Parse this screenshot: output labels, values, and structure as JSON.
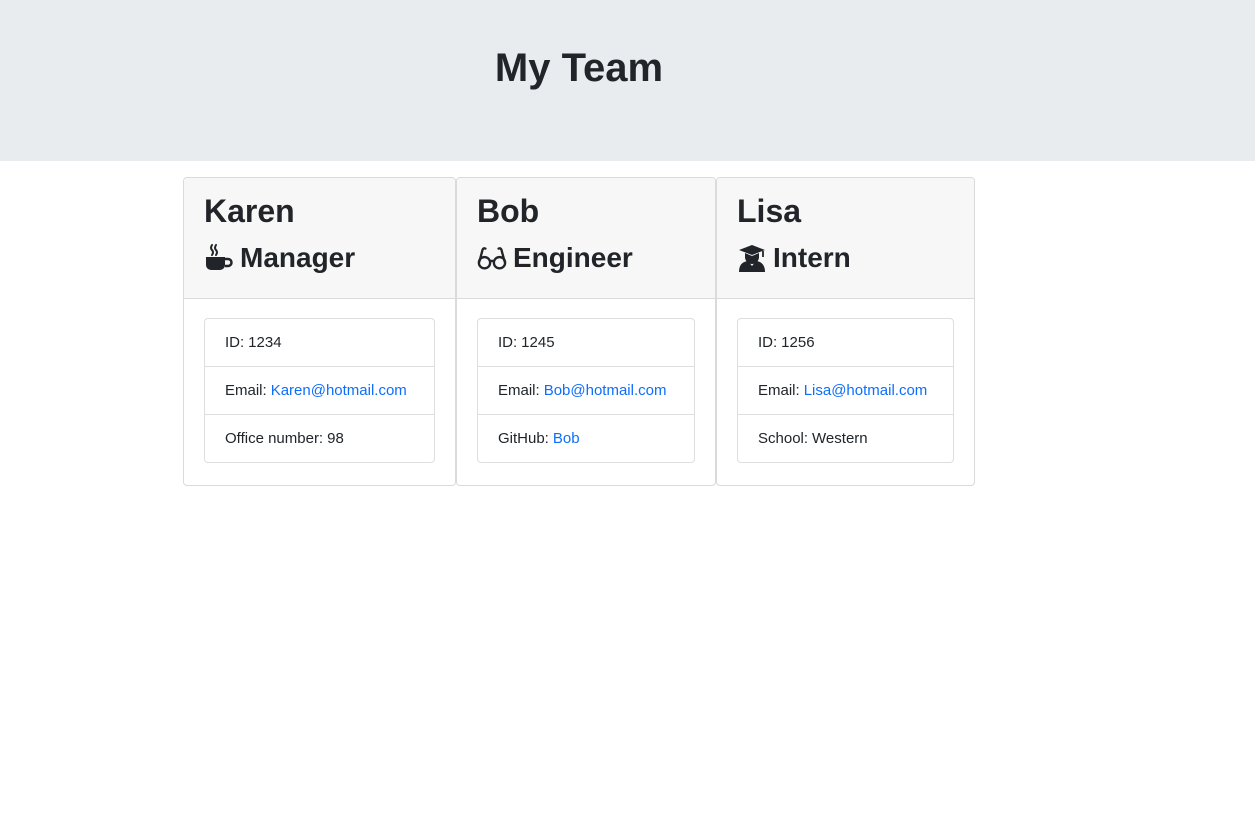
{
  "header": {
    "title": "My Team"
  },
  "colors": {
    "jumbotron_bg": "#e9ecef",
    "link": "#0d6efd",
    "card_header_bg": "#f7f7f7"
  },
  "cards": [
    {
      "name": "Karen",
      "role": "Manager",
      "role_icon": "coffee-icon",
      "id_label": "ID:",
      "id_value": "1234",
      "email_label": "Email:",
      "email_value": "Karen@hotmail.com",
      "extra_label": "Office number:",
      "extra_value": "98"
    },
    {
      "name": "Bob",
      "role": "Engineer",
      "role_icon": "glasses-icon",
      "id_label": "ID:",
      "id_value": "1245",
      "email_label": "Email:",
      "email_value": "Bob@hotmail.com",
      "extra_label": "GitHub:",
      "extra_value": "Bob"
    },
    {
      "name": "Lisa",
      "role": "Intern",
      "role_icon": "graduate-icon",
      "id_label": "ID:",
      "id_value": "1256",
      "email_label": "Email:",
      "email_value": "Lisa@hotmail.com",
      "extra_label": "School:",
      "extra_value": "Western"
    }
  ]
}
